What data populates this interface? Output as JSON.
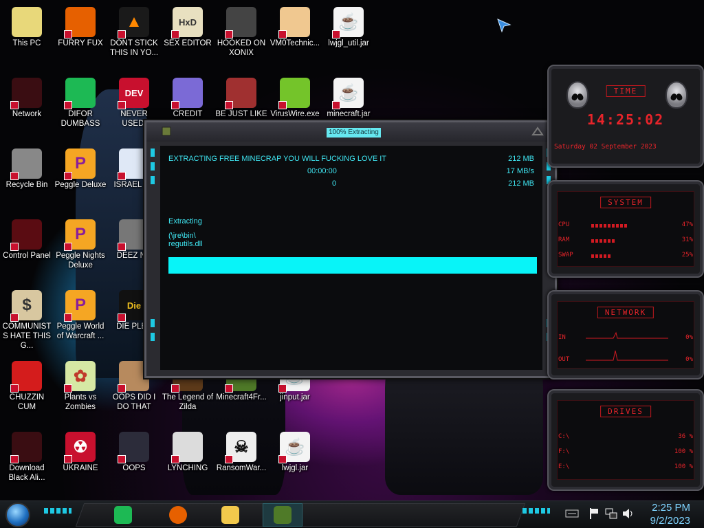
{
  "desktop_icons": [
    {
      "label": "This PC",
      "name": "desktop-icon-this-pc",
      "icon": "pc-icon",
      "glyph": "",
      "bg": "#e8d87a",
      "fg": "#222",
      "col": 0,
      "row": 0
    },
    {
      "label": "FURRY FUX",
      "name": "desktop-icon-furry-fux",
      "icon": "firefox-icon",
      "glyph": "",
      "bg": "#e66000",
      "fg": "#fff",
      "col": 1,
      "row": 0
    },
    {
      "label": "DONT STICK THIS IN YO...",
      "name": "desktop-icon-dont-stick",
      "icon": "vlc-cone-icon",
      "glyph": "▲",
      "bg": "#1a1a1a",
      "fg": "#ff8800",
      "col": 2,
      "row": 0
    },
    {
      "label": "SEX EDITOR",
      "name": "desktop-icon-sex-editor",
      "icon": "hxd-hex-editor-icon",
      "glyph": "HxD",
      "bg": "#e8e0c0",
      "fg": "#333",
      "col": 3,
      "row": 0
    },
    {
      "label": "HOOKED ON XONIX",
      "name": "desktop-icon-hooked-on-xonix",
      "icon": "xonix-game-icon",
      "glyph": "",
      "bg": "#444",
      "fg": "#fff",
      "col": 4,
      "row": 0
    },
    {
      "label": "VM0Technic...",
      "name": "desktop-icon-vm0technic",
      "icon": "doctor-person-icon",
      "glyph": "",
      "bg": "#f0c890",
      "fg": "#333",
      "col": 5,
      "row": 0
    },
    {
      "label": "lwjgl_util.jar",
      "name": "desktop-icon-lwjgl-util",
      "icon": "java-jar-icon",
      "glyph": "☕",
      "bg": "#f4f4f4",
      "fg": "#e76f00",
      "col": 6,
      "row": 0
    },
    {
      "label": "Network",
      "name": "desktop-icon-network",
      "icon": "alien-ware-icon",
      "glyph": "",
      "bg": "#3a0d12",
      "fg": "#fff",
      "col": 0,
      "row": 1
    },
    {
      "label": "DIFOR DUMBASS",
      "name": "desktop-icon-difor-dumbass",
      "icon": "spotify-like-green-icon",
      "glyph": "",
      "bg": "#1db954",
      "fg": "#fff",
      "col": 1,
      "row": 1
    },
    {
      "label": "NEVER USED!",
      "name": "desktop-icon-never-used",
      "icon": "dev-cpp-icon",
      "glyph": "DEV",
      "bg": "#c8102e",
      "fg": "#fff",
      "col": 2,
      "row": 1
    },
    {
      "label": "CREDIT CARD",
      "name": "desktop-icon-credit-card",
      "icon": "credit-card-icon",
      "glyph": "",
      "bg": "#7b6ad6",
      "fg": "#fff",
      "col": 3,
      "row": 1
    },
    {
      "label": "BE JUST LIKE",
      "name": "desktop-icon-be-just-like",
      "icon": "santa-picture-icon",
      "glyph": "",
      "bg": "#a03030",
      "fg": "#fff",
      "col": 4,
      "row": 1
    },
    {
      "label": "VirusWire.exe",
      "name": "desktop-icon-viruswire",
      "icon": "lime-icon",
      "glyph": "",
      "bg": "#74c42a",
      "fg": "#fff",
      "col": 5,
      "row": 1
    },
    {
      "label": "minecraft.jar",
      "name": "desktop-icon-minecraft-jar",
      "icon": "java-jar-icon",
      "glyph": "☕",
      "bg": "#f4f4f4",
      "fg": "#e76f00",
      "col": 6,
      "row": 1
    },
    {
      "label": "Recycle Bin",
      "name": "desktop-icon-recycle-bin",
      "icon": "recycle-bin-icon",
      "glyph": "",
      "bg": "#888",
      "fg": "#fff",
      "col": 0,
      "row": 2
    },
    {
      "label": "Peggle Deluxe",
      "name": "desktop-icon-peggle-deluxe",
      "icon": "peggle-icon",
      "glyph": "P",
      "bg": "#f5a623",
      "fg": "#8a1f9a",
      "col": 1,
      "row": 2
    },
    {
      "label": "ISRAEL SP",
      "name": "desktop-icon-israel-sp",
      "icon": "israel-flag-icon",
      "glyph": "",
      "bg": "#dfe8f6",
      "fg": "#1e4fa0",
      "col": 2,
      "row": 2
    },
    {
      "label": "Control Panel",
      "name": "desktop-icon-control-panel",
      "icon": "control-panel-icon",
      "glyph": "",
      "bg": "#5a0c12",
      "fg": "#fff",
      "col": 0,
      "row": 3
    },
    {
      "label": "Peggle Nights Deluxe",
      "name": "desktop-icon-peggle-nights",
      "icon": "peggle-icon",
      "glyph": "P",
      "bg": "#f5a623",
      "fg": "#8a1f9a",
      "col": 1,
      "row": 3
    },
    {
      "label": "DEEZ NU",
      "name": "desktop-icon-deez-nu",
      "icon": "stacked-windows-icon",
      "glyph": "",
      "bg": "#777",
      "fg": "#fff",
      "col": 2,
      "row": 3
    },
    {
      "label": "COMMUNISTS HATE THIS G...",
      "name": "desktop-icon-communists",
      "icon": "money-bag-icon",
      "glyph": "$",
      "bg": "#d8c7a0",
      "fg": "#333",
      "col": 0,
      "row": 4
    },
    {
      "label": "Peggle World of Warcraft ...",
      "name": "desktop-icon-peggle-wow",
      "icon": "peggle-icon",
      "glyph": "P",
      "bg": "#f5a623",
      "fg": "#8a1f9a",
      "col": 1,
      "row": 4
    },
    {
      "label": "DIE PLEA",
      "name": "desktop-icon-die-plea",
      "icon": "die-logo-icon",
      "glyph": "Die",
      "bg": "#111",
      "fg": "#f0c020",
      "col": 2,
      "row": 4
    },
    {
      "label": "CHUZZIN CUM",
      "name": "desktop-icon-chuzzin",
      "icon": "chuzzle-icon",
      "glyph": "",
      "bg": "#d41c1c",
      "fg": "#fff",
      "col": 0,
      "row": 5
    },
    {
      "label": "Plants vs Zombies",
      "name": "desktop-icon-plants-vs-zombies",
      "icon": "pvz-icon",
      "glyph": "✿",
      "bg": "#d6e8a4",
      "fg": "#c0392b",
      "col": 1,
      "row": 5
    },
    {
      "label": "OOPS DID I DO THAT",
      "name": "desktop-icon-oops-did-i",
      "icon": "portrait-icon",
      "glyph": "",
      "bg": "#b78a5e",
      "fg": "#fff",
      "col": 2,
      "row": 5
    },
    {
      "label": "The Legend of Zilda",
      "name": "desktop-icon-legend-of-zilda",
      "icon": "zelda-sprite-icon",
      "glyph": "",
      "bg": "#5d3a1a",
      "fg": "#fff",
      "col": 3,
      "row": 5
    },
    {
      "label": "Minecraft4Fr...",
      "name": "desktop-icon-minecraft4fr",
      "icon": "grass-block-icon",
      "glyph": "",
      "bg": "#4f7a28",
      "fg": "#fff",
      "col": 4,
      "row": 5
    },
    {
      "label": "jinput.jar",
      "name": "desktop-icon-jinput-jar",
      "icon": "java-jar-icon",
      "glyph": "☕",
      "bg": "#f4f4f4",
      "fg": "#e76f00",
      "col": 5,
      "row": 5
    },
    {
      "label": "Download Black Ali...",
      "name": "desktop-icon-download-black-ali",
      "icon": "alien-ware-icon",
      "glyph": "",
      "bg": "#3a0d12",
      "fg": "#fff",
      "col": 0,
      "row": 6
    },
    {
      "label": "UKRAINE",
      "name": "desktop-icon-ukraine",
      "icon": "radiation-icon",
      "glyph": "☢",
      "bg": "#c8102e",
      "fg": "#fff",
      "col": 1,
      "row": 6
    },
    {
      "label": "OOPS",
      "name": "desktop-icon-oops",
      "icon": "photo-frame-icon",
      "glyph": "",
      "bg": "#2c2c3a",
      "fg": "#fff",
      "col": 2,
      "row": 6
    },
    {
      "label": "LYNCHING",
      "name": "desktop-icon-lynching",
      "icon": "gear-flag-icon",
      "glyph": "",
      "bg": "#dcdcdc",
      "fg": "#333",
      "col": 3,
      "row": 6
    },
    {
      "label": "RansomWar...",
      "name": "desktop-icon-ransomware",
      "icon": "skull-icon",
      "glyph": "☠",
      "bg": "#eee",
      "fg": "#111",
      "col": 4,
      "row": 6
    },
    {
      "label": "lwjgl.jar",
      "name": "desktop-icon-lwjgl-jar",
      "icon": "java-jar-icon",
      "glyph": "☕",
      "bg": "#f4f4f4",
      "fg": "#e76f00",
      "col": 5,
      "row": 6
    }
  ],
  "dialog": {
    "title": "100% Extracting",
    "heading": "EXTRACTING FREE MINECRAP YOU WILL FUCKING LOVE IT",
    "total_size": "212 MB",
    "elapsed": "00:00:00",
    "speed": "17 MB/s",
    "remaining_counter": "0",
    "processed_size": "212 MB",
    "status": "Extracting",
    "path": "(\\jre\\bin\\",
    "file": "regutils.dll",
    "progress_percent": 100,
    "accent_color": "#08f4f8"
  },
  "widgets": {
    "time": {
      "header": "TIME",
      "clock": "14:25:02",
      "date": "Saturday 02 September 2023"
    },
    "system": {
      "header": "SYSTEM",
      "rows": [
        {
          "label": "CPU",
          "value": "47%",
          "level": 0.47
        },
        {
          "label": "RAM",
          "value": "31%",
          "level": 0.31
        },
        {
          "label": "SWAP",
          "value": "25%",
          "level": 0.25
        }
      ]
    },
    "network": {
      "header": "NETWORK",
      "rows": [
        {
          "label": "IN",
          "value": "0%"
        },
        {
          "label": "OUT",
          "value": "0%"
        }
      ]
    },
    "drives": {
      "header": "DRIVES",
      "rows": [
        {
          "label": "C:\\",
          "value": "36 %"
        },
        {
          "label": "F:\\",
          "value": "100 %"
        },
        {
          "label": "E:\\",
          "value": "100 %"
        }
      ]
    },
    "accent_color": "#e7242a"
  },
  "taskbar": {
    "pinned": [
      {
        "name": "taskbar-green-app-button",
        "icon": "green-chat-icon",
        "color": "#1db954"
      },
      {
        "name": "taskbar-firefox-button",
        "icon": "firefox-icon",
        "color": "#e66000"
      },
      {
        "name": "taskbar-file-explorer-button",
        "icon": "folder-icon",
        "color": "#f2c94c"
      },
      {
        "name": "taskbar-minecraft-button",
        "icon": "grass-block-icon",
        "color": "#4f7a28"
      }
    ],
    "tray_icons": [
      "flag-icon",
      "network-icon",
      "volume-icon",
      "keyboard-icon"
    ],
    "time": "2:25 PM",
    "date": "9/2/2023"
  }
}
